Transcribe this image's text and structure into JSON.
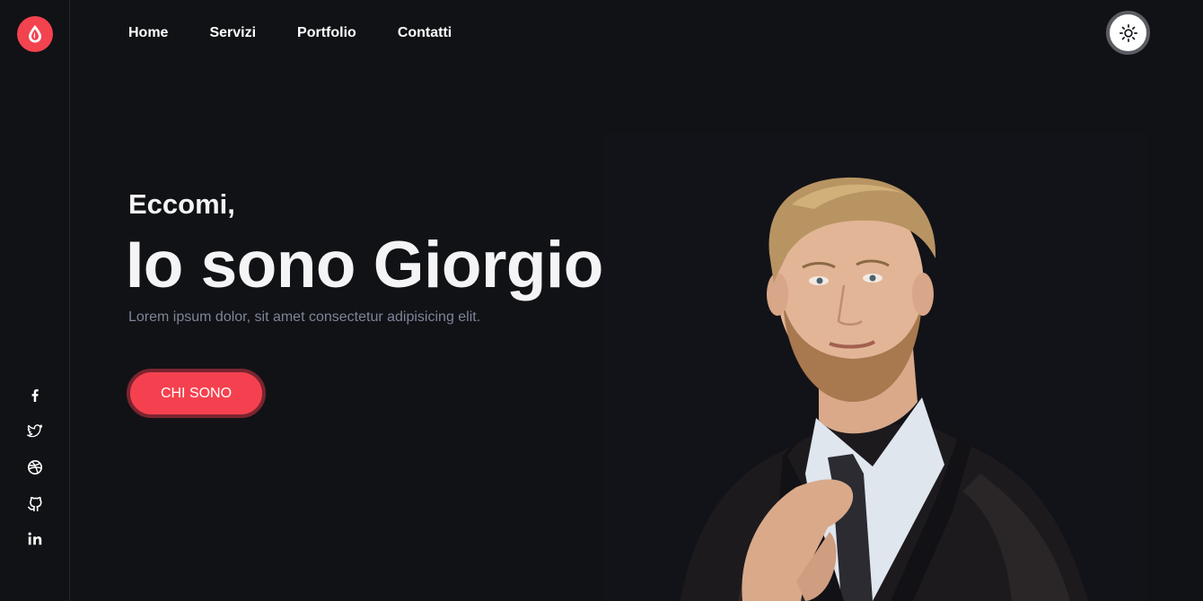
{
  "colors": {
    "background": "#111216",
    "accent": "#f5414f",
    "lead_text": "#7d8597"
  },
  "rail": {
    "logo_icon": "droplet-logo-icon",
    "socials": [
      {
        "name": "facebook-icon"
      },
      {
        "name": "twitter-icon"
      },
      {
        "name": "dribbble-icon"
      },
      {
        "name": "github-icon"
      },
      {
        "name": "linkedin-icon"
      }
    ]
  },
  "nav": {
    "items": [
      {
        "label": "Home"
      },
      {
        "label": "Servizi"
      },
      {
        "label": "Portfolio"
      },
      {
        "label": "Contatti"
      }
    ],
    "theme_toggle_icon": "sun-icon"
  },
  "hero": {
    "greeting": "Eccomi,",
    "headline": "Io sono Giorgio",
    "lead": "Lorem ipsum dolor, sit amet consectetur adipisicing elit.",
    "cta_label": "CHI SONO"
  },
  "portrait": {
    "subject": "portrait photo"
  }
}
